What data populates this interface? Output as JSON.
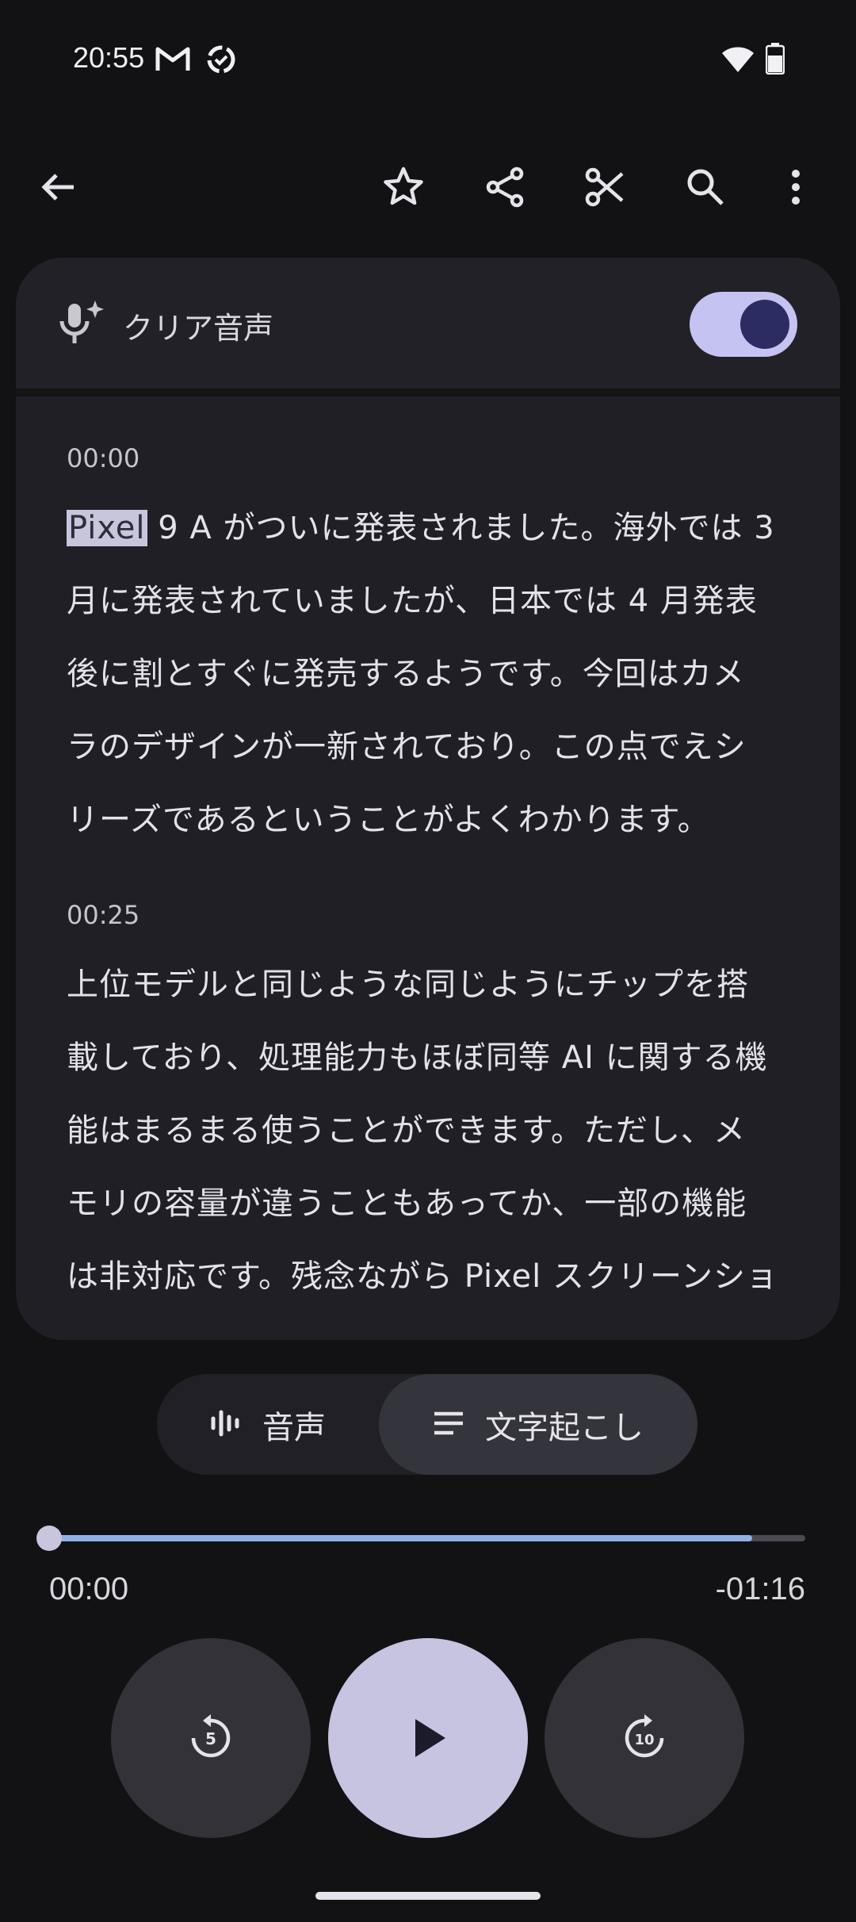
{
  "status_bar": {
    "time": "20:55",
    "icons": [
      "gmail-icon",
      "sync-icon",
      "wifi-icon",
      "battery-icon"
    ]
  },
  "toolbar": {
    "icons": [
      "back-arrow-icon",
      "star-icon",
      "share-icon",
      "scissors-icon",
      "search-icon",
      "more-vert-icon"
    ]
  },
  "clear_audio": {
    "label": "クリア音声",
    "enabled": true
  },
  "transcript": [
    {
      "time": "00:00",
      "highlight": "Pixel",
      "lines": [
        " 9 A がついに発表されました。海外では 3",
        "月に発表されていましたが、日本では 4 月発表",
        "後に割とすぐに発売するようです。今回はカメ",
        "ラのデザインが一新されており。この点でえシ",
        "リーズであるということがよくわかります。"
      ]
    },
    {
      "time": "00:25",
      "lines": [
        "上位モデルと同じような同じようにチップを搭",
        "載しており、処理能力もほぼ同等 AI に関する機",
        "能はまるまる使うことができます。ただし、メ",
        "モリの容量が違うこともあってか、一部の機能",
        "は非対応です。残念ながら Pixel スクリーンショ"
      ]
    }
  ],
  "tabs": {
    "audio_label": "音声",
    "transcript_label": "文字起こし",
    "selected": "transcript"
  },
  "player": {
    "elapsed": "00:00",
    "remaining": "-01:16",
    "buffered_fraction": 0.93,
    "position_fraction": 0.0,
    "rewind_seconds": "5",
    "forward_seconds": "10"
  },
  "colors": {
    "accent": "#c4c3f1",
    "progress": "#8fb1e5",
    "background": "#121214"
  }
}
